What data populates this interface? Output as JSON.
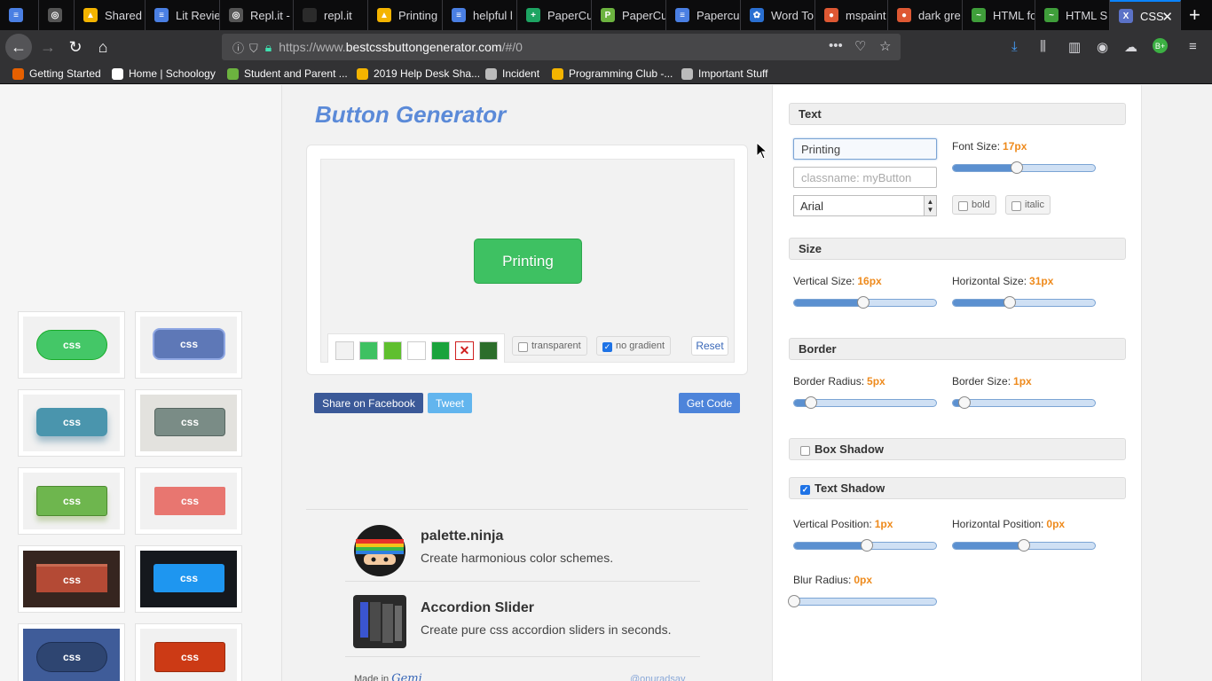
{
  "browser": {
    "tabs": [
      {
        "label": "",
        "color": "#4a7fe3",
        "glyph": "≡"
      },
      {
        "label": "",
        "color": "#555555",
        "glyph": "◎"
      },
      {
        "label": "Shared",
        "color": "#f4b400",
        "glyph": "▲"
      },
      {
        "label": "Lit Revie",
        "color": "#4a7fe3",
        "glyph": "≡"
      },
      {
        "label": "Repl.it -",
        "color": "#555555",
        "glyph": "◎"
      },
      {
        "label": "repl.it",
        "color": "#2b2b2b",
        "glyph": ""
      },
      {
        "label": "Printing",
        "color": "#f4b400",
        "glyph": "▲"
      },
      {
        "label": "helpful l",
        "color": "#4a7fe3",
        "glyph": "≡"
      },
      {
        "label": "PaperCu",
        "color": "#1da462",
        "glyph": "+"
      },
      {
        "label": "PaperCu",
        "color": "#6cb33f",
        "glyph": "P"
      },
      {
        "label": "Papercu",
        "color": "#4a7fe3",
        "glyph": "≡"
      },
      {
        "label": "Word To",
        "color": "#2a6fd1",
        "glyph": "✿"
      },
      {
        "label": "mspaint",
        "color": "#de5833",
        "glyph": "●"
      },
      {
        "label": "dark gre",
        "color": "#de5833",
        "glyph": "●"
      },
      {
        "label": "HTML fo",
        "color": "#3f9e3a",
        "glyph": "~"
      },
      {
        "label": "HTML S",
        "color": "#3f9e3a",
        "glyph": "~"
      },
      {
        "label": "CSS",
        "color": "#5b72c7",
        "glyph": "X"
      }
    ],
    "url_prefix": "https://www.",
    "url_domain": "bestcssbuttongenerator.com",
    "url_path": "/#/0",
    "bookmarks": [
      {
        "label": "Getting Started",
        "color": "#e66000"
      },
      {
        "label": "Home | Schoology",
        "color": "#ffffff"
      },
      {
        "label": "Student and Parent ...",
        "color": "#6cb33f"
      },
      {
        "label": "2019 Help Desk Sha...",
        "color": "#f4b400"
      },
      {
        "label": "Incident",
        "color": "#bbbbbb"
      },
      {
        "label": "Programming Club -...",
        "color": "#f4b400"
      },
      {
        "label": "Important Stuff",
        "color": "#bbbbbb"
      }
    ]
  },
  "app": {
    "title": "Button Generator",
    "preview_button_label": "Printing",
    "swatch_colors": [
      "#f2f2f2",
      "#3ec162",
      "#5fbf2e",
      "#ffffff",
      "#1aa33c",
      "x",
      "#2c6e2b"
    ],
    "transparent_label": "transparent",
    "transparent_checked": false,
    "no_gradient_label": "no gradient",
    "no_gradient_checked": true,
    "reset_label": "Reset",
    "share_facebook_label": "Share on Facebook",
    "tweet_label": "Tweet",
    "get_code_label": "Get Code",
    "sample_label": "css",
    "promos": [
      {
        "title": "palette.ninja",
        "desc": "Create harmonious color schemes."
      },
      {
        "title": "Accordion Slider",
        "desc": "Create pure css accordion sliders in seconds."
      }
    ],
    "made_in": "Made in",
    "author": "@onuradsay"
  },
  "settings": {
    "text": {
      "heading": "Text",
      "value": "Printing",
      "classname_placeholder": "classname: myButton",
      "font": "Arial",
      "font_size_label": "Font Size:",
      "font_size": "17px",
      "font_size_pct": 45,
      "bold_label": "bold",
      "italic_label": "italic"
    },
    "size": {
      "heading": "Size",
      "vertical_label": "Vertical Size:",
      "vertical": "16px",
      "vertical_pct": 49,
      "horizontal_label": "Horizontal Size:",
      "horizontal": "31px",
      "horizontal_pct": 40
    },
    "border": {
      "heading": "Border",
      "radius_label": "Border Radius:",
      "radius": "5px",
      "radius_pct": 12,
      "size_label": "Border Size:",
      "size": "1px",
      "size_pct": 8
    },
    "box_shadow": {
      "heading": "Box Shadow",
      "checked": false
    },
    "text_shadow": {
      "heading": "Text Shadow",
      "checked": true,
      "vpos_label": "Vertical Position:",
      "vpos": "1px",
      "vpos_pct": 51,
      "hpos_label": "Horizontal Position:",
      "hpos": "0px",
      "hpos_pct": 50,
      "blur_label": "Blur Radius:",
      "blur": "0px",
      "blur_pct": 0
    }
  }
}
